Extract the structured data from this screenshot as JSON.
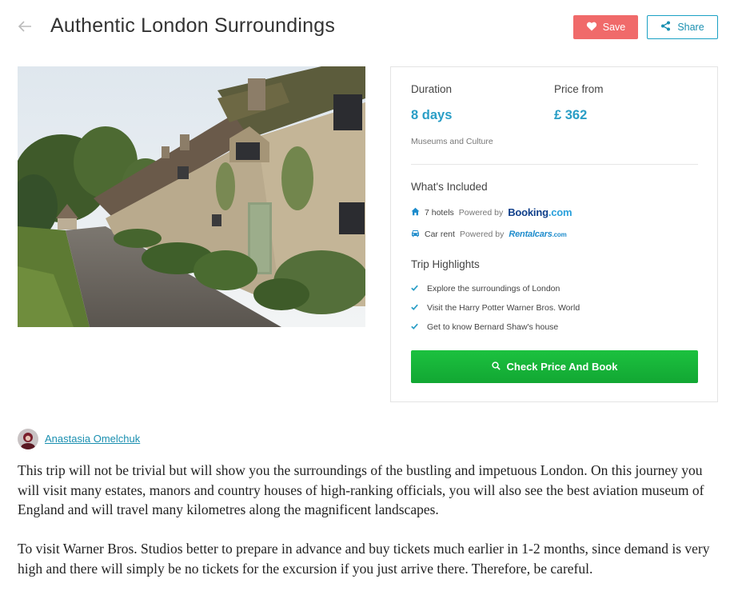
{
  "header": {
    "title": "Authentic London Surroundings",
    "save_label": "Save",
    "share_label": "Share"
  },
  "photo": {
    "alt": ""
  },
  "card": {
    "duration_label": "Duration",
    "duration_value": "8 days",
    "price_label": "Price from",
    "price_value": "£ 362",
    "category": "Museums and Culture",
    "included_title": "What's Included",
    "included": [
      {
        "icon": "home-icon",
        "text": "7 hotels",
        "powered": "Powered by",
        "brand": "Booking",
        "brand_suffix": ".com"
      },
      {
        "icon": "car-icon",
        "text": "Car rent",
        "powered": "Powered by",
        "brand": "Rentalcars",
        "brand_suffix": ".com"
      }
    ],
    "highlights_title": "Trip Highlights",
    "highlights": [
      "Explore the surroundings of London",
      "Visit the Harry Potter Warner Bros. World",
      "Get to know Bernard Shaw's house"
    ],
    "book_label": "Check Price And Book"
  },
  "author": {
    "name": "Anastasia Omelchuk"
  },
  "description": [
    "This trip will not be trivial but will show you the surroundings of the bustling and impetuous London. On this journey you will visit many estates, manors and country houses of high-ranking officials, you will also see the best aviation museum of England and will travel many kilometres along the magnificent landscapes.",
    "To visit Warner Bros. Studios better to prepare in advance and buy tickets much earlier in 1-2 months, since demand is very high and there will simply be no tickets for the excursion if you just arrive there. Therefore, be careful."
  ],
  "colors": {
    "accent": "#2a9ec6",
    "save": "#f06a6a",
    "book": "#18b43a"
  }
}
